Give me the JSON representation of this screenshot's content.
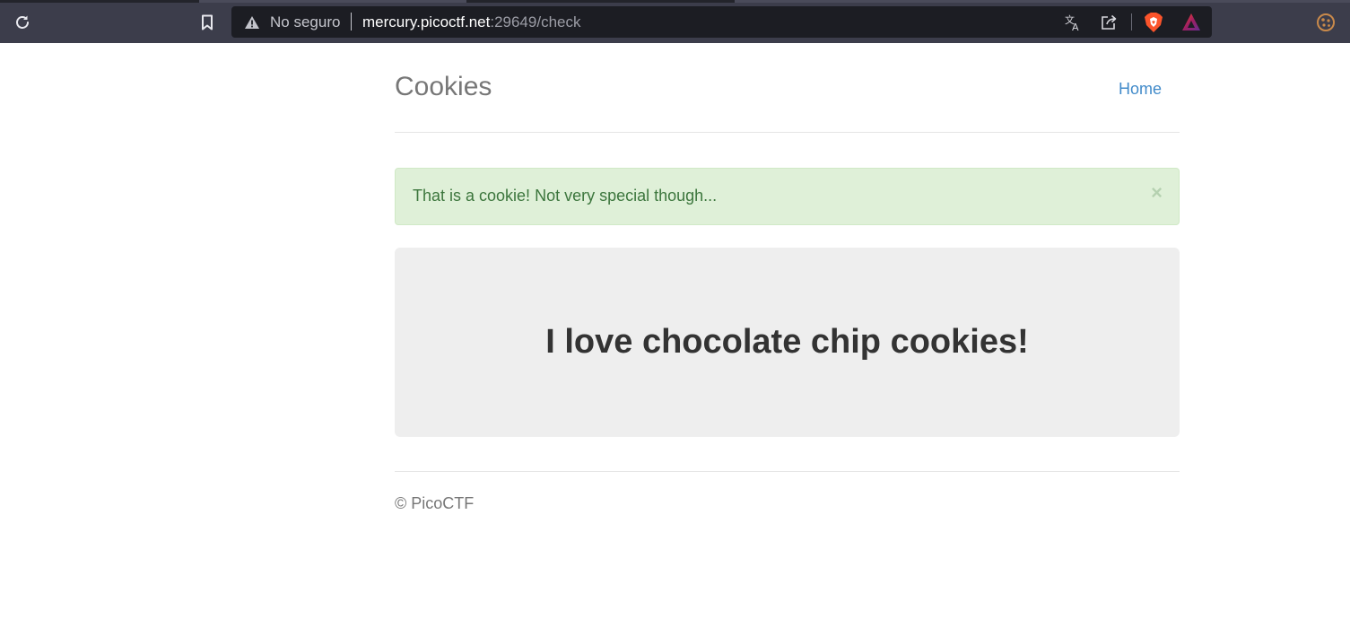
{
  "browser": {
    "not_secure_label": "No seguro",
    "url_host": "mercury.picoctf.net",
    "url_rest": ":29649/check",
    "icons": [
      "reload-icon",
      "bookmark-icon",
      "warning-icon",
      "translate-icon",
      "share-icon",
      "brave-shields-icon",
      "brave-rewards-icon",
      "cookie-extension-icon"
    ]
  },
  "header": {
    "title": "Cookies",
    "nav_home": "Home"
  },
  "alert": {
    "message": "That is a cookie! Not very special though...",
    "close_symbol": "×"
  },
  "jumbotron": {
    "heading": "I love chocolate chip cookies!"
  },
  "footer": {
    "text": "© PicoCTF"
  },
  "colors": {
    "chrome_bg": "#3c3d4b",
    "omnibox_bg": "#1c1d23",
    "link": "#428bca",
    "alert_bg": "#dff0d8",
    "alert_text": "#3c763d",
    "jumbotron_bg": "#eeeeee"
  }
}
